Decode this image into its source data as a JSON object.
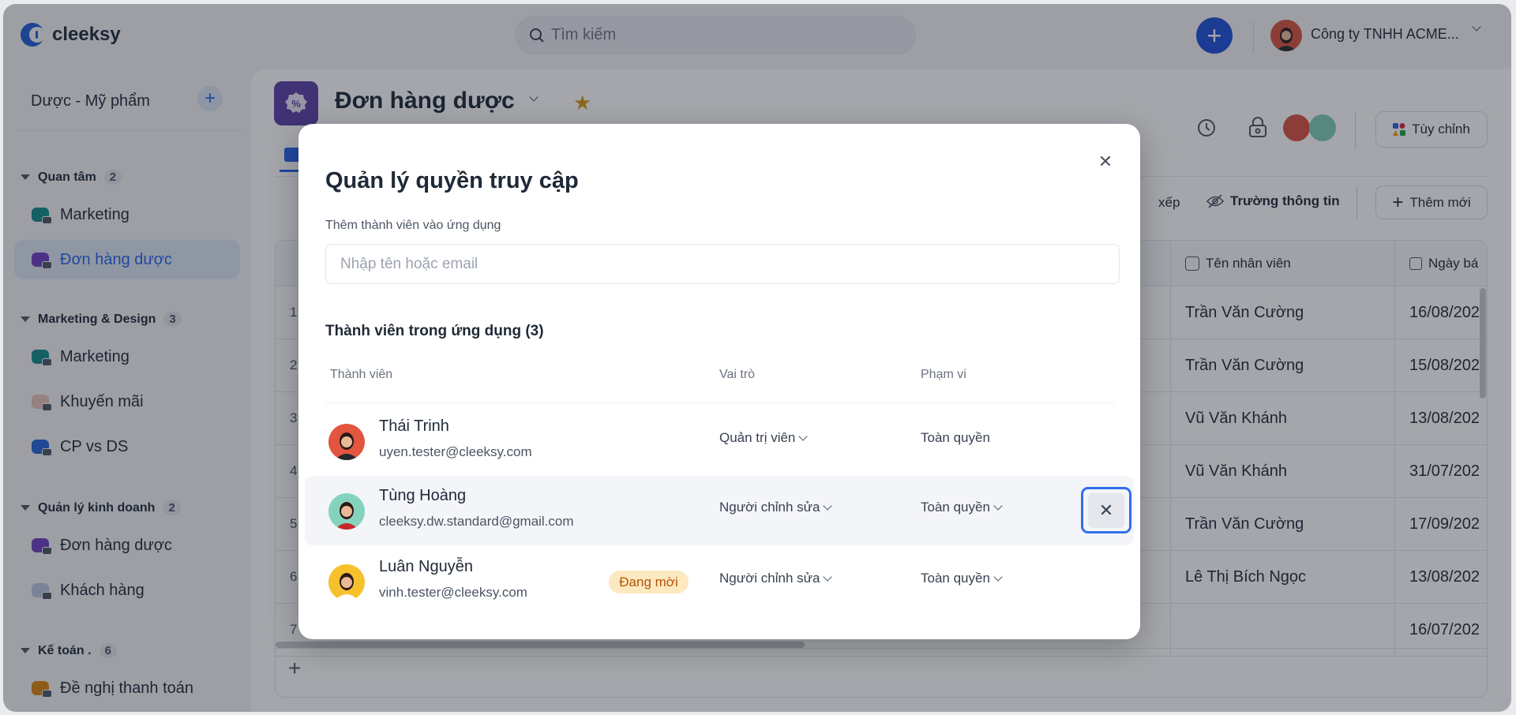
{
  "topbar": {
    "logo": "cleeksy",
    "search_placeholder": "Tìm kiếm",
    "company": "Công ty TNHH ACME...",
    "accent": "#1d4ed8"
  },
  "sidebar": {
    "workspace": "Dược - Mỹ phẩm",
    "groups": [
      {
        "label": "Quan tâm",
        "count": "2",
        "items": [
          {
            "label": "Marketing",
            "color": "#0f8a8a"
          },
          {
            "label": "Đơn hàng dược",
            "color": "#6d3fc0",
            "active": true
          }
        ]
      },
      {
        "label": "Marketing & Design",
        "count": "3",
        "items": [
          {
            "label": "Marketing",
            "color": "#0f8a8a"
          },
          {
            "label": "Khuyến mãi",
            "color": "#e8c4b8"
          },
          {
            "label": "CP vs DS",
            "color": "#2463d8"
          }
        ]
      },
      {
        "label": "Quản lý kinh doanh",
        "count": "2",
        "items": [
          {
            "label": "Đơn hàng dược",
            "color": "#6d3fc0"
          },
          {
            "label": "Khách hàng",
            "color": "#b7c6de"
          }
        ]
      },
      {
        "label": "Kế toán .",
        "count": "6",
        "items": [
          {
            "label": "Đề nghị thanh toán",
            "color": "#d9840f"
          }
        ]
      }
    ]
  },
  "main": {
    "title": "Đơn hàng dược",
    "customize": "Tùy chỉnh",
    "sort_partial": "xếp",
    "fields": "Trường thông tin",
    "add_new": "Thêm mới",
    "columns": [
      "Tên nhân viên",
      "Ngày bá"
    ],
    "rows": [
      {
        "n": "1",
        "name": "Trần Văn Cường",
        "date": "16/08/202"
      },
      {
        "n": "2",
        "name": "Trần Văn Cường",
        "date": "15/08/202"
      },
      {
        "n": "3",
        "name": "Vũ Văn Khánh",
        "date": "13/08/202"
      },
      {
        "n": "4",
        "name": "Vũ Văn Khánh",
        "date": "31/07/202"
      },
      {
        "n": "5",
        "name": "Trần Văn Cường",
        "date": "17/09/202"
      },
      {
        "n": "6",
        "name": "Lê Thị Bích Ngọc",
        "date": "13/08/202"
      },
      {
        "n": "7",
        "name": "",
        "date": "16/07/202"
      }
    ]
  },
  "modal": {
    "title": "Quản lý quyền truy cập",
    "add_label": "Thêm thành viên vào ứng dụng",
    "input_placeholder": "Nhập tên hoặc email",
    "section": "Thành viên trong ứng dụng (3)",
    "col_member": "Thành viên",
    "col_role": "Vai trò",
    "col_scope": "Phạm vi",
    "members": [
      {
        "name": "Thái Trinh",
        "email": "uyen.tester@cleeksy.com",
        "role": "Quản trị viên",
        "scope": "Toàn quyền"
      },
      {
        "name": "Tùng Hoàng",
        "email": "cleeksy.dw.standard@gmail.com",
        "role": "Người chỉnh sửa",
        "scope": "Toàn quyền"
      },
      {
        "name": "Luân Nguyễn",
        "email": "vinh.tester@cleeksy.com",
        "role": "Người chỉnh sửa",
        "scope": "Toàn quyền",
        "badge": "Đang mời"
      }
    ]
  }
}
